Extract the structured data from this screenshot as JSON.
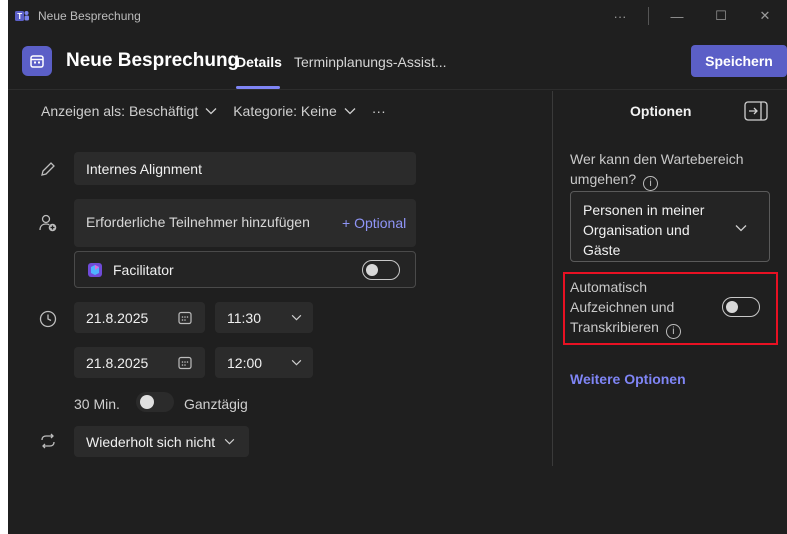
{
  "window": {
    "title": "Neue Besprechung",
    "controls": [
      "···",
      "—",
      "☐",
      "✕"
    ]
  },
  "header": {
    "title": "Neue Besprechung",
    "tabs": [
      "Details",
      "Terminplanungs-Assist..."
    ],
    "save_label": "Speichern"
  },
  "meta": {
    "show_as": "Anzeigen als: Beschäftigt",
    "category": "Kategorie: Keine",
    "more": "···"
  },
  "form": {
    "title_value": "Internes Alignment",
    "attendees_placeholder": "Erforderliche Teilnehmer hinzufügen",
    "optional_label": "+ Optional",
    "facilitator_label": "Facilitator",
    "start_date": "21.8.2025",
    "start_time": "11:30",
    "end_date": "21.8.2025",
    "end_time": "12:00",
    "duration": "30 Min.",
    "all_day_label": "Ganztägig",
    "repeat": "Wiederholt sich nicht"
  },
  "options": {
    "heading": "Optionen",
    "lobby_label": "Wer kann den Wartebereich umgehen?",
    "lobby_value": "Personen in meiner Organisation und Gäste",
    "record_label": "Automatisch Aufzeichnen und Transkribieren",
    "more_options": "Weitere Optionen"
  },
  "colors": {
    "accent": "#5b5fc7",
    "link": "#7f85f5",
    "highlight": "#e81123",
    "background": "#1f1f1f",
    "field": "#2b2b2b"
  }
}
